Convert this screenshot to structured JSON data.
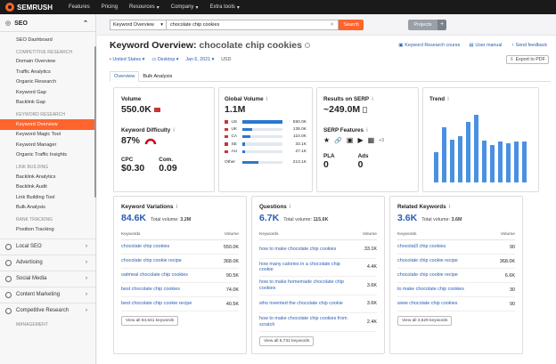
{
  "topbar": {
    "brand": "SEMRUSH",
    "nav": [
      "Features",
      "Pricing",
      "Resources",
      "Company",
      "Extra tools"
    ]
  },
  "sidebar": {
    "section_title": "SEO",
    "dashboard": "SEO Dashboard",
    "groups": [
      {
        "header": "COMPETITIVE RESEARCH",
        "items": [
          "Domain Overview",
          "Traffic Analytics",
          "Organic Research",
          "Keyword Gap",
          "Backlink Gap"
        ]
      },
      {
        "header": "KEYWORD RESEARCH",
        "items": [
          "Keyword Overview",
          "Keyword Magic Tool",
          "Keyword Manager",
          "Organic Traffic Insights"
        ]
      },
      {
        "header": "LINK BUILDING",
        "items": [
          "Backlink Analytics",
          "Backlink Audit",
          "Link Building Tool",
          "Bulk Analysis"
        ]
      },
      {
        "header": "RANK TRACKING",
        "items": [
          "Position Tracking"
        ]
      }
    ],
    "active_item": "Keyword Overview",
    "collapsed": [
      "Local SEO",
      "Advertising",
      "Social Media",
      "Content Marketing",
      "Competitive Research"
    ],
    "footer_header": "MANAGEMENT"
  },
  "search": {
    "database": "Keyword Overview",
    "query": "chocolate chip cookies",
    "button": "Search",
    "projects": "Projects",
    "plus": "+"
  },
  "page": {
    "title_prefix": "Keyword Overview:",
    "keyword": "chocolate chip cookies",
    "links": [
      "Keyword Research course",
      "User manual",
      "Send feedback"
    ],
    "filters": [
      "United States",
      "Desktop",
      "Jan 6, 2021"
    ],
    "currency": "USD",
    "export": "Export to PDF",
    "tabs": [
      "Overview",
      "Bulk Analysis"
    ]
  },
  "volume": {
    "label": "Volume",
    "value": "550.0K"
  },
  "difficulty": {
    "label": "Keyword Difficulty",
    "value": "87%"
  },
  "cpc": {
    "label": "CPC",
    "value": "$0.30"
  },
  "com": {
    "label": "Com.",
    "value": "0.09"
  },
  "global_volume": {
    "label": "Global Volume",
    "value": "1.1M",
    "rows": [
      {
        "country": "US",
        "value": "550.0K",
        "share": 1.0
      },
      {
        "country": "UK",
        "value": "135.0K",
        "share": 0.25
      },
      {
        "country": "CA",
        "value": "110.0K",
        "share": 0.2
      },
      {
        "country": "SE",
        "value": "33.1K",
        "share": 0.07
      },
      {
        "country": "AU",
        "value": "27.1K",
        "share": 0.05
      }
    ],
    "other_label": "Other",
    "other_value": "213.1K",
    "other_share": 0.39
  },
  "serp": {
    "label": "Results on SERP",
    "value": "~249.0M",
    "features_label": "SERP Features",
    "features_more": "+3",
    "pla_label": "PLA",
    "pla_value": "0",
    "ads_label": "Ads",
    "ads_value": "0"
  },
  "trend": {
    "label": "Trend",
    "values": [
      0.45,
      0.82,
      0.63,
      0.68,
      0.9,
      1.0,
      0.62,
      0.55,
      0.6,
      0.58,
      0.6,
      0.6
    ]
  },
  "variations": {
    "label": "Keyword Variations",
    "count": "84.6K",
    "total_label": "Total volume:",
    "total": "3.2M",
    "col1": "Keywords",
    "col2": "Volume",
    "rows": [
      {
        "kw": "chocolate chip cookies",
        "vol": "550.0K"
      },
      {
        "kw": "chocolate chip cookie recipe",
        "vol": "368.0K"
      },
      {
        "kw": "oatmeal chocolate chip cookies",
        "vol": "90.5K"
      },
      {
        "kw": "best chocolate chip cookies",
        "vol": "74.0K"
      },
      {
        "kw": "best chocolate chip cookie recipe",
        "vol": "40.5K"
      }
    ],
    "view_all": "View all 84,641 keywords"
  },
  "questions": {
    "label": "Questions",
    "count": "6.7K",
    "total_label": "Total volume:",
    "total": "115.6K",
    "col1": "Keywords",
    "col2": "Volume",
    "rows": [
      {
        "kw": "how to make chocolate chip cookies",
        "vol": "33.1K"
      },
      {
        "kw": "how many calories in a chocolate chip cookie",
        "vol": "4.4K"
      },
      {
        "kw": "how to make homemade chocolate chip cookies",
        "vol": "3.6K"
      },
      {
        "kw": "who invented the chocolate chip cookie",
        "vol": "3.6K"
      },
      {
        "kw": "how to make chocolate chip cookies from scratch",
        "vol": "2.4K"
      }
    ],
    "view_all": "View all 6,731 keywords"
  },
  "related": {
    "label": "Related Keywords",
    "count": "3.6K",
    "total_label": "Total volume:",
    "total": "3.6M",
    "col1": "Keywords",
    "col2": "Volume",
    "rows": [
      {
        "kw": "chocolat3 chip cookies",
        "vol": "90"
      },
      {
        "kw": "chocolate chip cookie recipe",
        "vol": "368.0K"
      },
      {
        "kw": "chocolate chip cookie recipe",
        "vol": "6.6K"
      },
      {
        "kw": "to make chocolate chip cookies",
        "vol": "30"
      },
      {
        "kw": "www chocolate chip cookies",
        "vol": "90"
      }
    ],
    "view_all": "View all 3,629 keywords"
  }
}
